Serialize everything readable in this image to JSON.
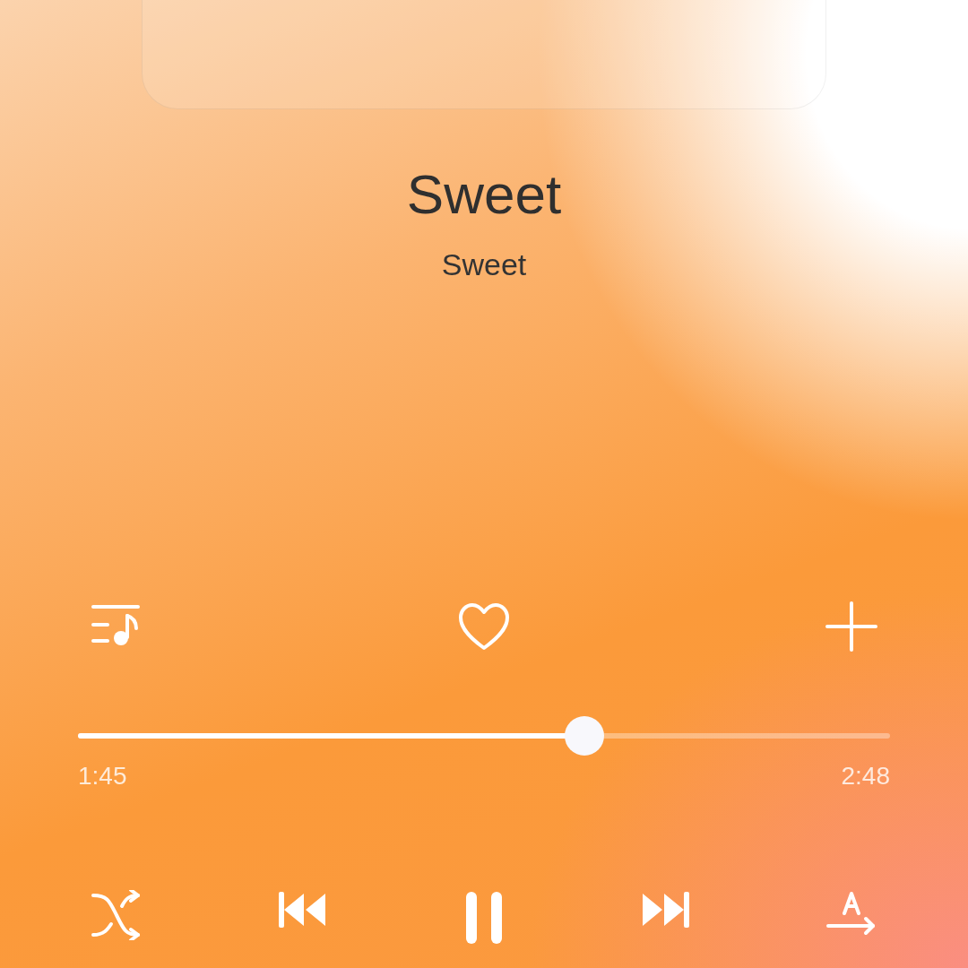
{
  "track": {
    "title": "Sweet",
    "artist": "Sweet",
    "liked": false,
    "playing": true
  },
  "progress": {
    "level": 0.624,
    "elapsed": "1:45",
    "duration": "2:48"
  }
}
